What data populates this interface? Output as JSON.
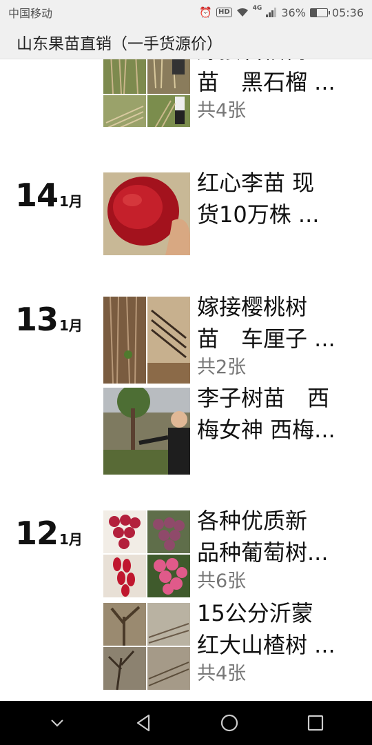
{
  "status_bar": {
    "carrier": "中国移动",
    "signal_label": "4G",
    "battery_percent": "36%",
    "battery_level": 0.36,
    "time": "05:36",
    "hd_label": "HD"
  },
  "header": {
    "title": "山东果苗直销（一手货源价）"
  },
  "days": [
    {
      "day": "",
      "month": "",
      "posts": [
        {
          "line1": "嫁接石榴树",
          "line2": "苗　黑石榴 ...",
          "count": "共4张",
          "thumb_type": "grid",
          "icon": "pomegranate-seedlings"
        }
      ]
    },
    {
      "day": "14",
      "month": "1月",
      "posts": [
        {
          "line1": "红心李苗 现",
          "line2": "货10万株 ...",
          "count": "",
          "thumb_type": "single",
          "icon": "red-plum-fruit"
        }
      ]
    },
    {
      "day": "13",
      "month": "1月",
      "posts": [
        {
          "line1": "嫁接樱桃树",
          "line2": "苗　车厘子 ...",
          "count": "共2张",
          "thumb_type": "pair",
          "icon": "cherry-seedlings"
        },
        {
          "line1": "李子树苗　西",
          "line2": "梅女神 西梅...",
          "count": "",
          "thumb_type": "single",
          "icon": "plum-tree-man"
        }
      ]
    },
    {
      "day": "12",
      "month": "1月",
      "posts": [
        {
          "line1": "各种优质新",
          "line2": "品种葡萄树...",
          "count": "共6张",
          "thumb_type": "grid",
          "icon": "grapes"
        },
        {
          "line1": "15公分沂蒙",
          "line2": "红大山楂树 ...",
          "count": "共4张",
          "thumb_type": "grid",
          "icon": "hawthorn-trees"
        }
      ]
    }
  ],
  "colors": {
    "statusbar_bg": "#f0f0f0",
    "text_primary": "#111111",
    "text_secondary": "#777777",
    "navbar_bg": "#000000"
  },
  "nav": {
    "icons": [
      "chevron-down-icon",
      "back-icon",
      "home-icon",
      "recents-icon"
    ]
  }
}
